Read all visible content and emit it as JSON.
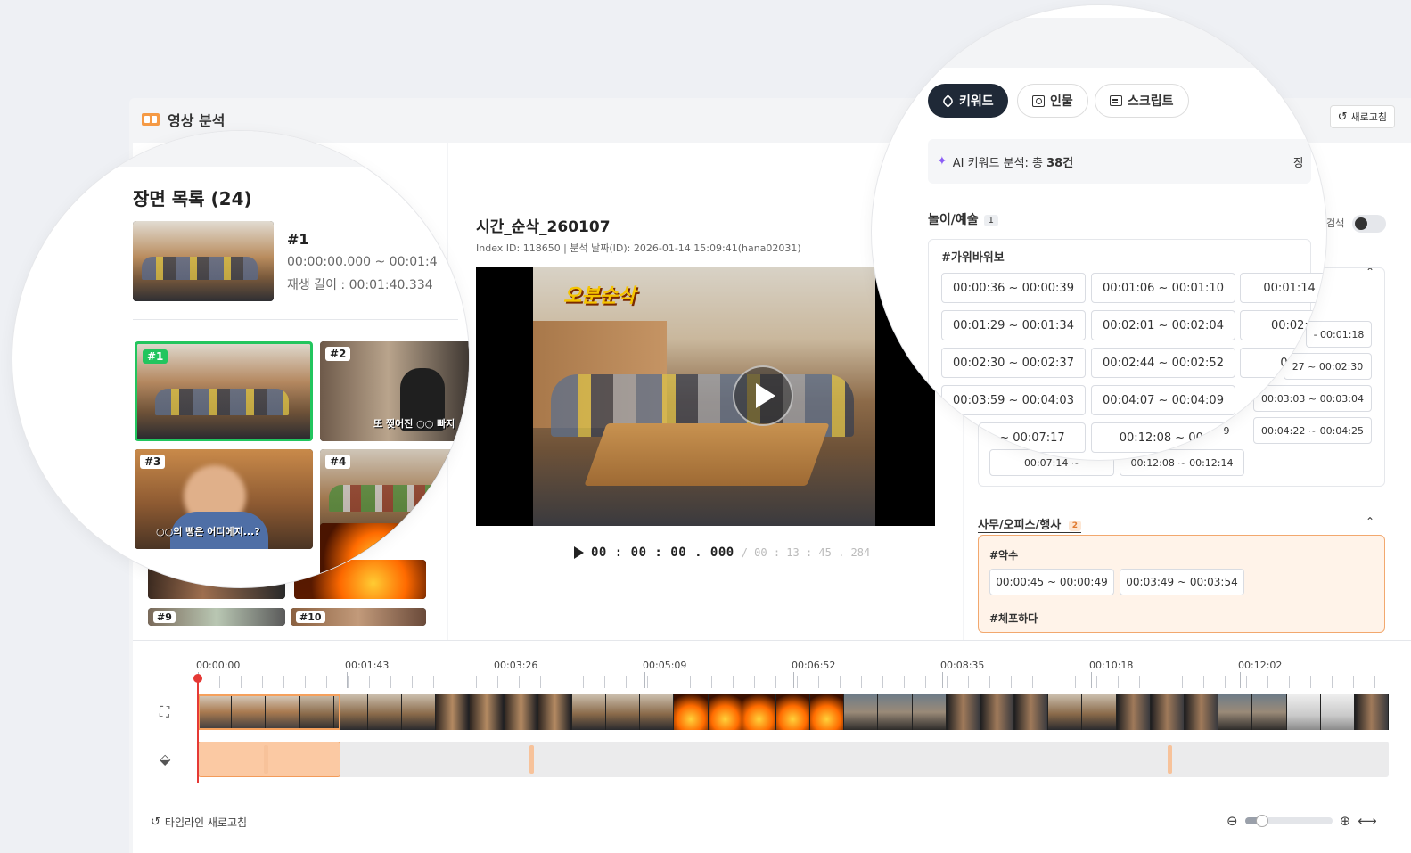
{
  "header": {
    "title": "영상 분석",
    "refresh_label": "새로고침"
  },
  "scenes": {
    "title": "장면 목록 (24)",
    "featured": {
      "number": "#1",
      "range": "00:00:00.000 ~ 00:01:4",
      "duration": "재생 길이 : 00:01:40.334"
    },
    "items": [
      {
        "label": "#1",
        "caption": ""
      },
      {
        "label": "#2",
        "caption": "또 찢어진 ○○ 빠지"
      },
      {
        "label": "#3",
        "caption": "○○의 빵은 어디에지...?"
      },
      {
        "label": "#4",
        "caption": ""
      },
      {
        "label": "#9",
        "caption": ""
      },
      {
        "label": "#10",
        "caption": ""
      }
    ]
  },
  "video": {
    "title": "시간_순삭_260107",
    "meta": "Index ID: 118650 | 분석 날짜(ID): 2026-01-14 15:09:41(hana02031)",
    "logo_text": "오분순삭",
    "current_time": "00 : 00 : 00 . 000",
    "total_time": "/ 00 : 13 : 45 . 284"
  },
  "tabs": [
    {
      "label": "키워드",
      "icon": "tag-icon",
      "active": true
    },
    {
      "label": "인물",
      "icon": "person-icon",
      "active": false
    },
    {
      "label": "스크립트",
      "icon": "script-icon",
      "active": false
    }
  ],
  "ai_summary": {
    "prefix": "AI 키워드 분석: 총 ",
    "count": "38건",
    "trailing": "장"
  },
  "search_label": "검색",
  "categories": {
    "play": {
      "title": "놀이/예술",
      "count": "1",
      "keyword": "#가위바위보",
      "chips": [
        "00:00:36 ~ 00:00:39",
        "00:01:06 ~ 00:01:10",
        "00:01:14 -",
        "00:01:29 ~ 00:01:34",
        "00:02:01 ~ 00:02:04",
        "00:02:2",
        "00:02:30 ~ 00:02:37",
        "00:02:44 ~ 00:02:52",
        "00:0",
        "00:03:59 ~ 00:04:03",
        "00:04:07 ~ 00:04:09",
        "~ 00:07:17",
        "00:12:08 ~ 00:"
      ],
      "outside_chips": [
        "- 00:01:18",
        "27 ~ 00:02:30",
        "00:03:03 ~ 00:03:04",
        "00:04:22 ~ 00:04:25",
        "9",
        "00:07:14 ~",
        "00:12:08 ~ 00:12:14"
      ]
    },
    "office": {
      "title": "사무/오피스/행사",
      "count": "2",
      "keyword1": "#악수",
      "chips": [
        "00:00:45 ~ 00:00:49",
        "00:03:49 ~ 00:03:54"
      ],
      "keyword2": "#체포하다"
    }
  },
  "timeline": {
    "ticks": [
      "00:00:00",
      "00:01:43",
      "00:03:26",
      "00:05:09",
      "00:06:52",
      "00:08:35",
      "00:10:18",
      "00:12:02"
    ],
    "refresh_label": "타임라인 새로고침",
    "zoom_level": 0.2
  },
  "colors": {
    "accent": "#1f2937",
    "selection": "#22c55e",
    "tag_fill": "#fbc9a3",
    "tag_border": "#f39b5a",
    "playhead": "#e53935"
  }
}
